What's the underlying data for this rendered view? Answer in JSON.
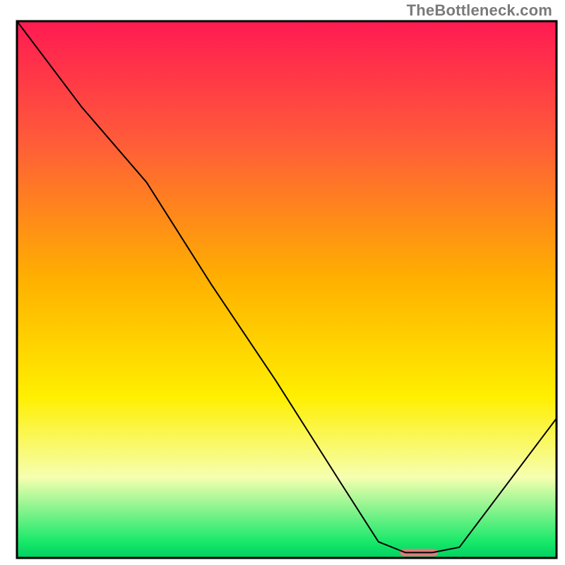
{
  "watermark": "TheBottleneck.com",
  "chart_data": {
    "type": "line",
    "title": "",
    "xlabel": "",
    "ylabel": "",
    "xlim": [
      0,
      100
    ],
    "ylim": [
      0,
      100
    ],
    "grid": false,
    "legend": null,
    "background": {
      "type": "vertical-gradient",
      "stops": [
        {
          "y": 0,
          "color": "#ff1a52"
        },
        {
          "y": 22,
          "color": "#ff5a3a"
        },
        {
          "y": 48,
          "color": "#ffb000"
        },
        {
          "y": 70,
          "color": "#ffef00"
        },
        {
          "y": 85,
          "color": "#f6ffb0"
        },
        {
          "y": 97,
          "color": "#18e86a"
        },
        {
          "y": 100,
          "color": "#00d060"
        }
      ]
    },
    "series": [
      {
        "name": "bottleneck-curve",
        "color": "#000000",
        "stroke_width": 2,
        "x": [
          0.0,
          12,
          24,
          36,
          48,
          60,
          67,
          72,
          77,
          82,
          100
        ],
        "y": [
          100,
          84,
          70,
          51,
          33,
          14,
          3,
          1,
          1,
          2,
          26
        ]
      }
    ],
    "markers": [
      {
        "name": "optimal-range",
        "shape": "rounded-bar",
        "color": "#e07a7a",
        "x_start": 71,
        "x_end": 78,
        "y": 1.0,
        "height": 1.4
      }
    ],
    "frame": {
      "color": "#000000",
      "width": 3
    }
  }
}
